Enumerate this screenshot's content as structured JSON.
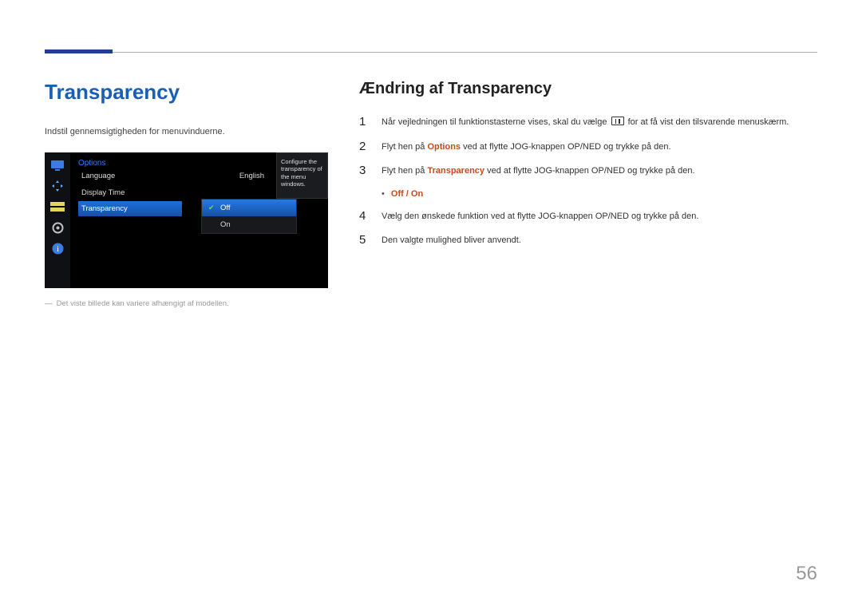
{
  "title_primary": "Transparency",
  "intro": "Indstil gennemsigtigheden for menuvinduerne.",
  "osd": {
    "heading": "Options",
    "rows": {
      "language_label": "Language",
      "language_value": "English",
      "displaytime_label": "Display Time",
      "transparency_label": "Transparency"
    },
    "tooltip": "Configure the transparency of the menu windows.",
    "submenu": {
      "off": "Off",
      "on": "On"
    }
  },
  "footnote": "Det viste billede kan variere afhængigt af modellen.",
  "title_secondary": "Ændring af Transparency",
  "steps": {
    "s1_pre": "Når vejledningen til funktionstasterne vises, skal du vælge ",
    "s1_post": " for at få vist den tilsvarende menuskærm.",
    "s2_pre": "Flyt hen på ",
    "s2_hl": "Options",
    "s2_post": " ved at flytte JOG-knappen OP/NED og trykke på den.",
    "s3_pre": "Flyt hen på ",
    "s3_hl": "Transparency",
    "s3_post": " ved at flytte JOG-knappen OP/NED og trykke på den.",
    "bullet": "Off / On",
    "s4": "Vælg den ønskede funktion ved at flytte JOG-knappen OP/NED og trykke på den.",
    "s5": "Den valgte mulighed bliver anvendt."
  },
  "nums": {
    "n1": "1",
    "n2": "2",
    "n3": "3",
    "n4": "4",
    "n5": "5"
  },
  "page_number": "56"
}
